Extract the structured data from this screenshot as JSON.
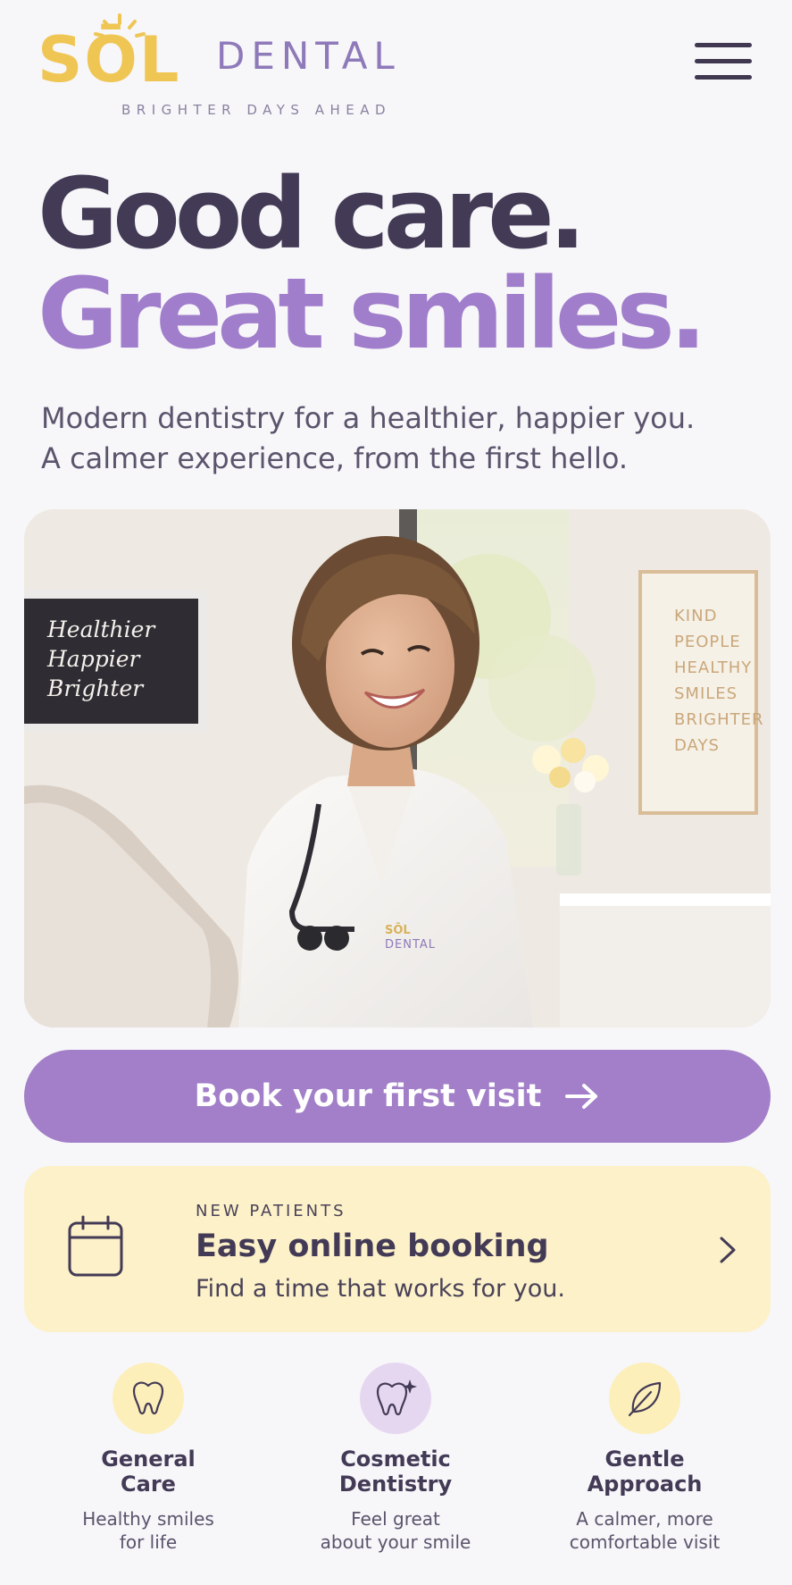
{
  "brand": {
    "logo_primary": "SŌL",
    "logo_secondary": "DENTAL",
    "tagline": "BRIGHTER DAYS AHEAD"
  },
  "nav": {
    "menu_icon": "hamburger-menu-icon"
  },
  "hero": {
    "title_line1": "Good care.",
    "title_line2": "Great smiles.",
    "subtitle_line1": "Modern dentistry for a healthier, happier you.",
    "subtitle_line2": "A calmer experience, from the first hello."
  },
  "hero_image": {
    "monitor_lines": [
      "Healthier",
      "Happier",
      "Brighter"
    ],
    "poster_lines": [
      "KIND",
      "PEOPLE",
      "HEALTHY",
      "SMILES",
      "BRIGHTER",
      "DAYS"
    ],
    "coat_logo_primary": "SŌL",
    "coat_logo_secondary": "DENTAL"
  },
  "cta": {
    "label": "Book your first visit",
    "icon": "arrow-right-icon"
  },
  "booking": {
    "eyebrow": "NEW PATIENTS",
    "title": "Easy online booking",
    "subtitle": "Find a time that works for you.",
    "icon": "calendar-icon"
  },
  "features": [
    {
      "title_line1": "General",
      "title_line2": "Care",
      "desc_line1": "Healthy smiles",
      "desc_line2": "for life",
      "icon": "tooth-icon"
    },
    {
      "title_line1": "Cosmetic",
      "title_line2": "Dentistry",
      "desc_line1": "Feel great",
      "desc_line2": "about your smile",
      "icon": "sparkle-tooth-icon"
    },
    {
      "title_line1": "Gentle",
      "title_line2": "Approach",
      "desc_line1": "A calmer, more",
      "desc_line2": "comfortable visit",
      "icon": "leaf-icon"
    }
  ],
  "colors": {
    "purple": "#a27fc8",
    "yellow": "#efc654",
    "dark": "#433a56",
    "cream": "#fcf1c8",
    "lavender_circle": "#e6d7f1",
    "yellow_circle": "#fcefb9"
  }
}
